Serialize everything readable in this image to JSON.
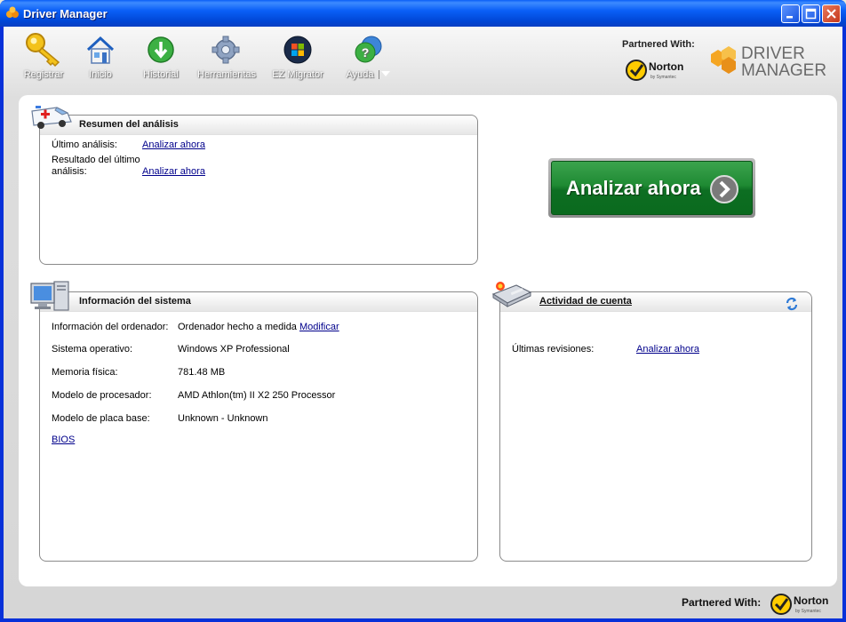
{
  "window": {
    "title": "Driver Manager"
  },
  "toolbar": {
    "items": [
      {
        "label": "Registrar",
        "icon": "key-icon"
      },
      {
        "label": "Inicio",
        "icon": "home-icon"
      },
      {
        "label": "Historial",
        "icon": "history-icon"
      },
      {
        "label": "Herramientas",
        "icon": "gear-icon"
      },
      {
        "label": "EZ Migrator",
        "icon": "windows-orb-icon"
      },
      {
        "label": "Ayuda",
        "icon": "help-icon"
      }
    ]
  },
  "branding": {
    "partnered_with": "Partnered With:",
    "norton": "Norton",
    "norton_sub": "by Symantec",
    "logo_line1": "DRIVER",
    "logo_line2": "MANAGER"
  },
  "scan_summary": {
    "title": "Resumen del análisis",
    "last_scan_label": "Último análisis:",
    "last_scan_link": "Analizar ahora",
    "last_result_label_1": "Resultado del último",
    "last_result_label_2": "análisis:",
    "last_result_link": "Analizar ahora"
  },
  "scan_button": {
    "label": "Analizar ahora"
  },
  "system_info": {
    "title": "Información del sistema",
    "rows": [
      {
        "label": "Información del ordenador:",
        "value": "Ordenador hecho a medida",
        "link": "Modificar"
      },
      {
        "label": "Sistema operativo:",
        "value": "Windows XP Professional"
      },
      {
        "label": "Memoria física:",
        "value": "781.48 MB"
      },
      {
        "label": "Modelo de procesador:",
        "value": "AMD Athlon(tm) II X2 250 Processor"
      },
      {
        "label": "Modelo de placa base:",
        "value": "Unknown - Unknown"
      }
    ],
    "bios_link": "BIOS"
  },
  "account_activity": {
    "title": "Actividad de cuenta",
    "last_reviews_label": "Últimas revisiones:",
    "last_reviews_link": "Analizar ahora"
  },
  "footer": {
    "partnered_with": "Partnered With:"
  },
  "colors": {
    "titlebar": "#0a5ff7",
    "scan_button": "#1f8a33",
    "link": "#00008b",
    "logo_orange": "#f5a623"
  }
}
